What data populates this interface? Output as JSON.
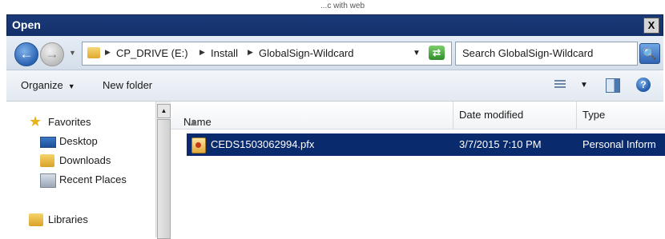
{
  "background_strip": {
    "text": "...c with web"
  },
  "window": {
    "title": "Open",
    "close": "X"
  },
  "nav": {
    "back_glyph": "←",
    "forward_glyph": "→"
  },
  "address": {
    "crumbs": [
      "CP_DRIVE (E:)",
      "Install",
      "GlobalSign-Wildcard"
    ]
  },
  "search": {
    "placeholder": "Search GlobalSign-Wildcard",
    "button_glyph": "🔍"
  },
  "toolbar": {
    "organize_label": "Organize",
    "new_folder_label": "New folder",
    "help_glyph": "?"
  },
  "sidebar": {
    "items": [
      {
        "label": "Favorites",
        "icon": "star-icon"
      },
      {
        "label": "Desktop",
        "icon": "desktop-icon"
      },
      {
        "label": "Downloads",
        "icon": "downloads-icon"
      },
      {
        "label": "Recent Places",
        "icon": "recent-places-icon"
      },
      {
        "label": "Libraries",
        "icon": "libraries-icon"
      }
    ]
  },
  "files": {
    "columns": [
      "Name",
      "Date modified",
      "Type"
    ],
    "rows": [
      {
        "name": "CEDS1503062994.pfx",
        "date": "3/7/2015 7:10 PM",
        "type": "Personal Inform",
        "selected": true
      }
    ]
  },
  "colors": {
    "selection": "#0a2a6e",
    "title_bar": "#1a3a78",
    "accent": "#2a63b3"
  }
}
